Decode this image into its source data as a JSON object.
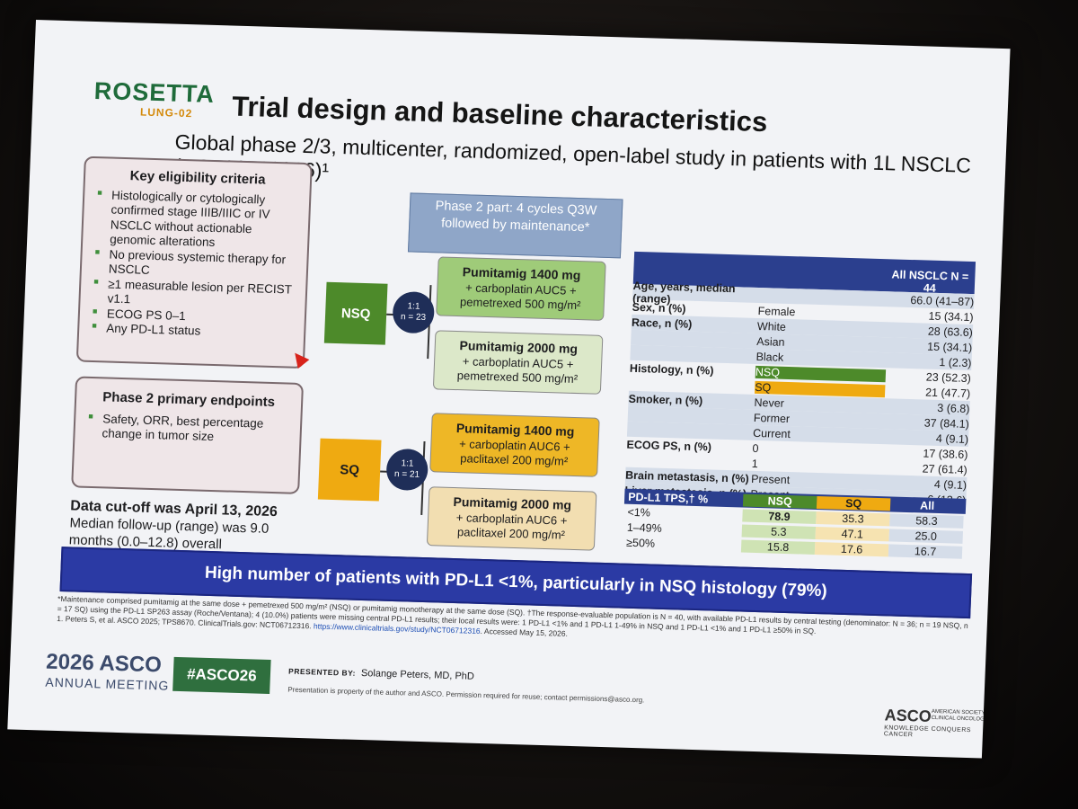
{
  "logo": {
    "word": "ROSETTA",
    "sub": "LUNG-02"
  },
  "title": "Trial design and baseline characteristics",
  "subtitle": "Global phase 2/3, multicenter, randomized, open-label study in patients with 1L NSCLC (NCT06712316)¹",
  "eligibility": {
    "heading": "Key eligibility criteria",
    "items": [
      "Histologically or cytologically confirmed stage IIIB/IIIC or IV NSCLC without actionable genomic alterations",
      "No previous systemic therapy for NSCLC",
      "≥1 measurable lesion per RECIST v1.1",
      "ECOG PS 0–1",
      "Any PD-L1 status"
    ]
  },
  "endpoints": {
    "heading": "Phase 2 primary endpoints",
    "items": [
      "Safety, ORR, best percentage change in tumor size"
    ]
  },
  "cutoff": {
    "line1": "Data cut-off was April 13, 2026",
    "line2": "Median follow-up (range) was 9.0 months (0.0–12.8) overall"
  },
  "design": {
    "phase_box": "Phase 2 part: 4 cycles Q3W followed by maintenance*",
    "nsq": "NSQ",
    "sq": "SQ",
    "rand_nsq": {
      "ratio": "1:1",
      "n": "n = 23"
    },
    "rand_sq": {
      "ratio": "1:1",
      "n": "n = 21"
    },
    "arms": [
      {
        "drug": "Pumitamig 1400 mg",
        "l2": "+ carboplatin AUC5 +",
        "l3": "pemetrexed 500 mg/m²"
      },
      {
        "drug": "Pumitamig 2000 mg",
        "l2": "+ carboplatin AUC5 +",
        "l3": "pemetrexed 500 mg/m²"
      },
      {
        "drug": "Pumitamig 1400 mg",
        "l2": "+ carboplatin AUC6 +",
        "l3": "paclitaxel 200 mg/m²"
      },
      {
        "drug": "Pumitamig 2000 mg",
        "l2": "+ carboplatin AUC6 +",
        "l3": "paclitaxel 200 mg/m²"
      }
    ]
  },
  "baseline": {
    "header": "All NSCLC N = 44",
    "rows": [
      {
        "label": "Age, years, median (range)",
        "sub": "",
        "value": "66.0 (41–87)"
      },
      {
        "label": "Sex, n (%)",
        "sub": "Female",
        "value": "15 (34.1)"
      },
      {
        "label": "Race, n (%)",
        "sub": "White",
        "value": "28 (63.6)"
      },
      {
        "label": "",
        "sub": "Asian",
        "value": "15 (34.1)"
      },
      {
        "label": "",
        "sub": "Black",
        "value": "1 (2.3)"
      },
      {
        "label": "Histology, n (%)",
        "sub": "NSQ",
        "value": "23 (52.3)"
      },
      {
        "label": "",
        "sub": "SQ",
        "value": "21 (47.7)"
      },
      {
        "label": "Smoker, n (%)",
        "sub": "Never",
        "value": "3 (6.8)"
      },
      {
        "label": "",
        "sub": "Former",
        "value": "37 (84.1)"
      },
      {
        "label": "",
        "sub": "Current",
        "value": "4 (9.1)"
      },
      {
        "label": "ECOG PS, n (%)",
        "sub": "0",
        "value": "17 (38.6)"
      },
      {
        "label": "",
        "sub": "1",
        "value": "27 (61.4)"
      },
      {
        "label": "Brain metastasis, n (%)",
        "sub": "Present",
        "value": "4 (9.1)"
      },
      {
        "label": "Liver metastasis, n (%)",
        "sub": "Present",
        "value": "6 (13.6)"
      }
    ]
  },
  "pdl1": {
    "header": [
      "PD-L1 TPS,† %",
      "NSQ",
      "SQ",
      "All"
    ],
    "rows": [
      [
        "<1%",
        "78.9",
        "35.3",
        "58.3"
      ],
      [
        "1–49%",
        "5.3",
        "47.1",
        "25.0"
      ],
      [
        "≥50%",
        "15.8",
        "17.6",
        "16.7"
      ]
    ]
  },
  "banner": "High number of patients with PD-L1 <1%, particularly in NSQ histology (79%)",
  "footnotes": {
    "f1": "*Maintenance comprised pumitamig at the same dose + pemetrexed 500 mg/m² (NSQ) or pumitamig monotherapy at the same dose (SQ). †The response-evaluable population is N = 40, with available PD-L1 results by central testing (denominator: N = 36; n = 19 NSQ, n = 17 SQ) using the PD-L1 SP263 assay (Roche/Ventana); 4 (10.0%) patients were missing central PD-L1 results; their local results were: 1 PD-L1 <1% and 1 PD-L1 1-49% in NSQ and 1 PD-L1 <1% and 1 PD-L1 ≥50% in SQ.",
    "f2": "1. Peters S, et al. ASCO 2025; TPS8670. ClinicalTrials.gov: NCT06712316.",
    "link": "https://www.clinicaltrials.gov/study/NCT06712316",
    "f3": ". Accessed May 15, 2026."
  },
  "footer": {
    "asco": "2026 ASCO",
    "meeting": "ANNUAL MEETING",
    "hashtag": "#ASCO26",
    "presented_label": "PRESENTED BY:",
    "presenter": "Solange Peters, MD, PhD",
    "property": "Presentation is property of the author and ASCO. Permission required for reuse; contact permissions@asco.org.",
    "asco_logo": "ASCO",
    "asco_tag": "AMERICAN SOCIETY OF CLINICAL ONCOLOGY",
    "asco_motto": "KNOWLEDGE CONQUERS CANCER"
  }
}
